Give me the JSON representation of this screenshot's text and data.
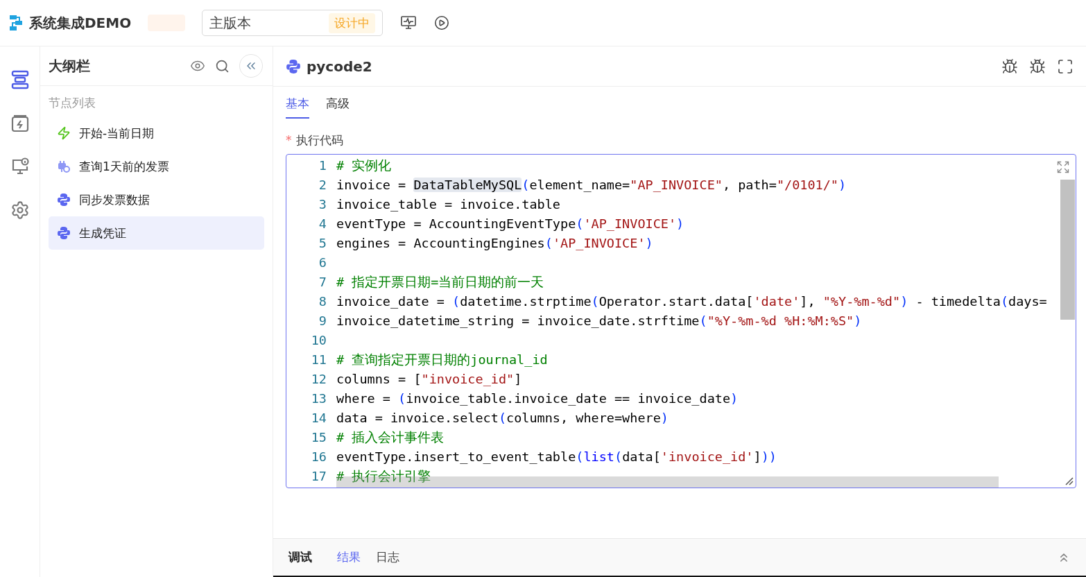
{
  "app": {
    "title": "系统集成DEMO",
    "version": "主版本",
    "version_status": "设计中"
  },
  "rail": [
    {
      "kind": "outline",
      "selected": true
    },
    {
      "kind": "trigger",
      "selected": false
    },
    {
      "kind": "monitor",
      "selected": false
    },
    {
      "kind": "settings",
      "selected": false
    }
  ],
  "outline": {
    "title": "大纲栏",
    "section": "节点列表",
    "items": [
      {
        "kind": "trigger",
        "label": "开始-当前日期",
        "selected": false
      },
      {
        "kind": "query",
        "label": "查询1天前的发票",
        "selected": false
      },
      {
        "kind": "python",
        "label": "同步发票数据",
        "selected": false
      },
      {
        "kind": "python",
        "label": "生成凭证",
        "selected": true
      }
    ]
  },
  "node": {
    "title": "pycode2",
    "tabs": [
      {
        "label": "基本",
        "selected": true
      },
      {
        "label": "高级",
        "selected": false
      }
    ],
    "field_label": "执行代码",
    "required_mark": "*"
  },
  "code": [
    {
      "number": "1",
      "tokens": [
        {
          "kind": "comment",
          "text": "# 实例化"
        }
      ]
    },
    {
      "number": "2",
      "tokens": [
        {
          "kind": "plain",
          "text": "invoice = "
        },
        {
          "kind": "highlight",
          "text": "DataTableMySQL"
        },
        {
          "kind": "paren",
          "text": "("
        },
        {
          "kind": "plain",
          "text": "element_name="
        },
        {
          "kind": "string",
          "text": "\"AP_INVOICE\""
        },
        {
          "kind": "plain",
          "text": ", path="
        },
        {
          "kind": "string",
          "text": "\"/0101/\""
        },
        {
          "kind": "paren",
          "text": ")"
        }
      ]
    },
    {
      "number": "3",
      "tokens": [
        {
          "kind": "plain",
          "text": "invoice_table = invoice.table"
        }
      ]
    },
    {
      "number": "4",
      "tokens": [
        {
          "kind": "plain",
          "text": "eventType = AccountingEventType"
        },
        {
          "kind": "paren",
          "text": "("
        },
        {
          "kind": "string",
          "text": "'AP_INVOICE'"
        },
        {
          "kind": "paren",
          "text": ")"
        }
      ]
    },
    {
      "number": "5",
      "tokens": [
        {
          "kind": "plain",
          "text": "engines = AccountingEngines"
        },
        {
          "kind": "paren",
          "text": "("
        },
        {
          "kind": "string",
          "text": "'AP_INVOICE'"
        },
        {
          "kind": "paren",
          "text": ")"
        }
      ]
    },
    {
      "number": "6"
    },
    {
      "number": "7",
      "tokens": [
        {
          "kind": "comment",
          "text": "# 指定开票日期=当前日期的前一天"
        }
      ]
    },
    {
      "number": "8",
      "tokens": [
        {
          "kind": "plain",
          "text": "invoice_date = "
        },
        {
          "kind": "paren",
          "text": "("
        },
        {
          "kind": "plain",
          "text": "datetime.strptime"
        },
        {
          "kind": "paren",
          "text": "("
        },
        {
          "kind": "plain",
          "text": "Operator.start.data["
        },
        {
          "kind": "string",
          "text": "'date'"
        },
        {
          "kind": "plain",
          "text": "], "
        },
        {
          "kind": "string",
          "text": "\"%Y-%m-%d\""
        },
        {
          "kind": "paren",
          "text": ")"
        },
        {
          "kind": "plain",
          "text": " - timedelta"
        },
        {
          "kind": "paren",
          "text": "("
        },
        {
          "kind": "plain",
          "text": "days="
        }
      ]
    },
    {
      "number": "9",
      "tokens": [
        {
          "kind": "plain",
          "text": "invoice_datetime_string = invoice_date.strftime"
        },
        {
          "kind": "paren",
          "text": "("
        },
        {
          "kind": "string",
          "text": "\"%Y-%m-%d %H:%M:%S\""
        },
        {
          "kind": "paren",
          "text": ")"
        }
      ]
    },
    {
      "number": "10"
    },
    {
      "number": "11",
      "tokens": [
        {
          "kind": "comment",
          "text": "# 查询指定开票日期的journal_id"
        }
      ]
    },
    {
      "number": "12",
      "tokens": [
        {
          "kind": "plain",
          "text": "columns = ["
        },
        {
          "kind": "string",
          "text": "\"invoice_id\""
        },
        {
          "kind": "plain",
          "text": "]"
        }
      ]
    },
    {
      "number": "13",
      "tokens": [
        {
          "kind": "plain",
          "text": "where = "
        },
        {
          "kind": "paren",
          "text": "("
        },
        {
          "kind": "plain",
          "text": "invoice_table.invoice_date == invoice_date"
        },
        {
          "kind": "paren",
          "text": ")"
        }
      ]
    },
    {
      "number": "14",
      "tokens": [
        {
          "kind": "plain",
          "text": "data = invoice.select"
        },
        {
          "kind": "paren",
          "text": "("
        },
        {
          "kind": "plain",
          "text": "columns, where=where"
        },
        {
          "kind": "paren",
          "text": ")"
        }
      ]
    },
    {
      "number": "15",
      "tokens": [
        {
          "kind": "comment",
          "text": "# 插入会计事件表"
        }
      ]
    },
    {
      "number": "16",
      "tokens": [
        {
          "kind": "plain",
          "text": "eventType.insert_to_event_table"
        },
        {
          "kind": "paren",
          "text": "("
        },
        {
          "kind": "builtin",
          "text": "list"
        },
        {
          "kind": "paren",
          "text": "("
        },
        {
          "kind": "plain",
          "text": "data["
        },
        {
          "kind": "string",
          "text": "'invoice_id'"
        },
        {
          "kind": "plain",
          "text": "]"
        },
        {
          "kind": "paren",
          "text": "))"
        }
      ]
    },
    {
      "number": "17",
      "tokens": [
        {
          "kind": "comment",
          "text": "# 执行会计引擎"
        }
      ]
    }
  ],
  "debug": {
    "title": "调试",
    "tabs": [
      {
        "label": "结果",
        "selected": true
      },
      {
        "label": "日志",
        "selected": false
      }
    ]
  }
}
